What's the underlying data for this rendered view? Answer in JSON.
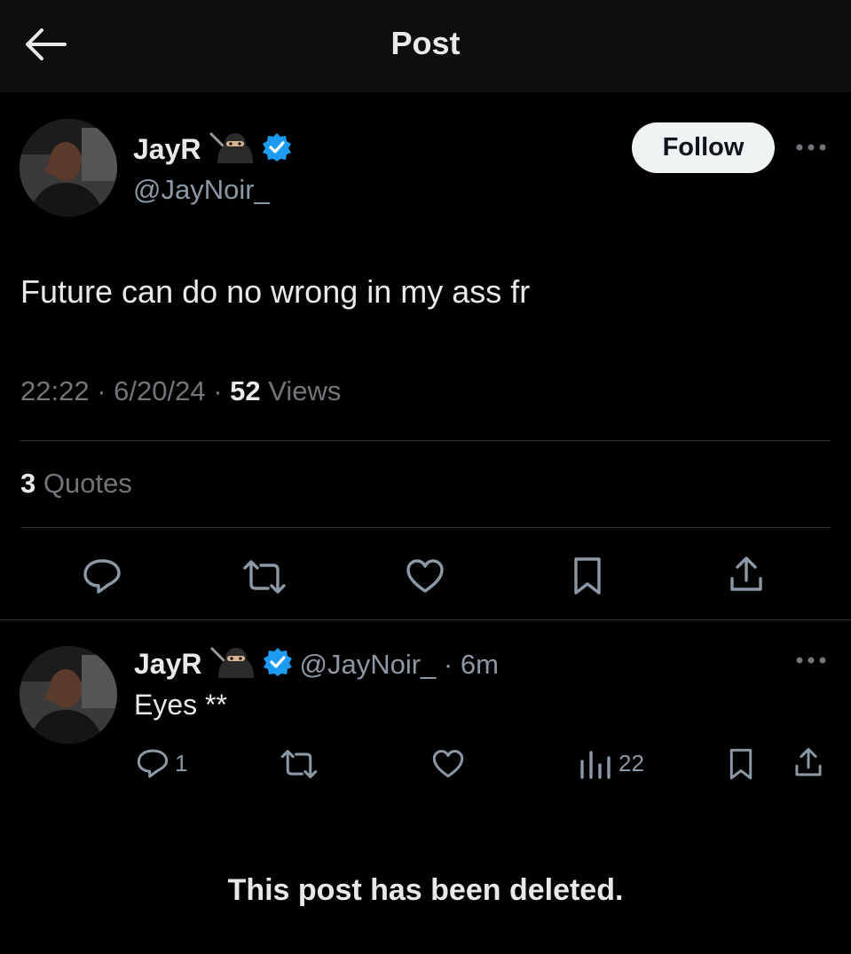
{
  "header": {
    "title": "Post",
    "back_icon": "arrow-left-icon"
  },
  "main_post": {
    "author_name": "JayR",
    "author_emoji": "ninja-emoji",
    "handle": "@JayNoir_",
    "follow_label": "Follow",
    "text": "Future can do no wrong in my ass fr",
    "time": "22:22",
    "date": "6/20/24",
    "views_count": "52",
    "views_label": "Views",
    "quotes_count": "3",
    "quotes_label": "Quotes",
    "actions": [
      "reply-icon",
      "repost-icon",
      "like-icon",
      "bookmark-icon",
      "share-icon"
    ]
  },
  "reply_post": {
    "author_name": "JayR",
    "handle_time": "@JayNoir_ · 6m",
    "text": "Eyes **",
    "reply_count": "1",
    "views_count": "22"
  },
  "deleted_notice": "This post has been deleted.",
  "colors": {
    "background": "#000000",
    "header": "#0e0e0e",
    "verified": "#1d9bf0",
    "muted": "#71767b"
  }
}
